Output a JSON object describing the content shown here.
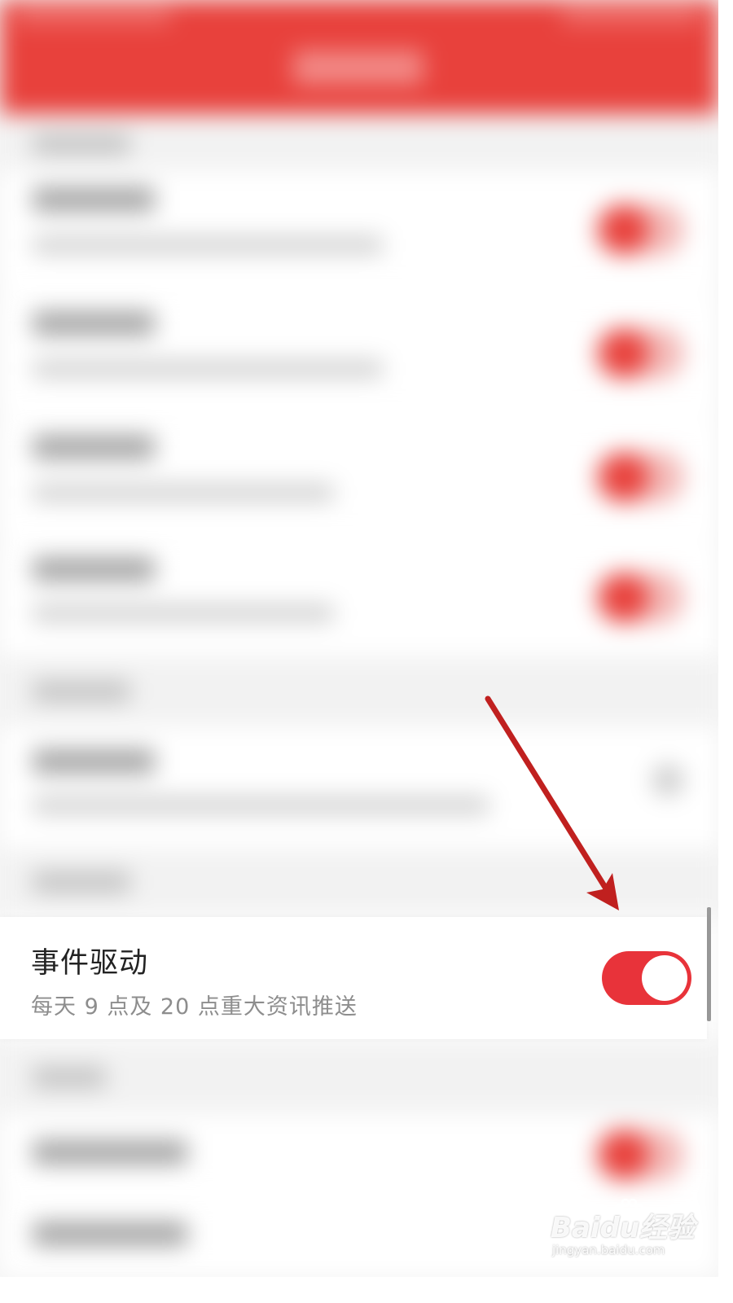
{
  "event_driven_row": {
    "title": "事件驱动",
    "subtitle": "每天 9 点及 20 点重大资讯推送",
    "toggle_on": true
  },
  "colors": {
    "accent": "#e8333a",
    "header": "#e8413c",
    "arrow": "#c0201f"
  },
  "watermark": {
    "logo": "Baidu经验",
    "url": "jingyan.baidu.com"
  }
}
